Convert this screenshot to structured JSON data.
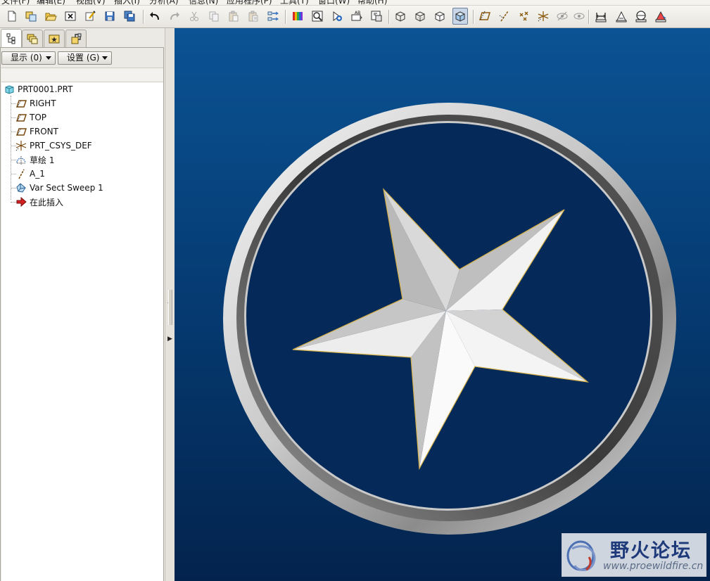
{
  "menubar": {
    "items": [
      "文件(F)",
      "编辑(E)",
      "视图(V)",
      "插入(I)",
      "分析(A)",
      "信息(N)",
      "应用程序(P)",
      "工具(T)",
      "窗口(W)",
      "帮助(H)"
    ]
  },
  "toolbar": {
    "buttons": [
      {
        "icon": "new-file-icon"
      },
      {
        "icon": "open-session-icon"
      },
      {
        "icon": "open-folder-icon"
      },
      {
        "icon": "close-window-icon"
      },
      {
        "icon": "regenerate-icon"
      },
      {
        "icon": "save-icon"
      },
      {
        "icon": "save-copy-icon"
      },
      {
        "icon": "undo-icon"
      },
      {
        "icon": "redo-icon"
      },
      {
        "icon": "cut-icon"
      },
      {
        "icon": "copy-icon"
      },
      {
        "icon": "paste-icon"
      },
      {
        "icon": "paste-special-icon"
      },
      {
        "icon": "swap-icon"
      },
      {
        "icon": "color-bar-icon"
      },
      {
        "icon": "zoom-fit-icon"
      },
      {
        "icon": "zoom-in-icon"
      },
      {
        "icon": "annotation-icon"
      },
      {
        "icon": "repaint-icon"
      },
      {
        "icon": "wireframe-icon"
      },
      {
        "icon": "hidden-line-icon"
      },
      {
        "icon": "no-hidden-icon"
      },
      {
        "icon": "shading-icon"
      },
      {
        "icon": "datum-plane-icon"
      },
      {
        "icon": "datum-axis-icon"
      },
      {
        "icon": "datum-point-icon"
      },
      {
        "icon": "csys-icon"
      },
      {
        "icon": "hide-icon"
      },
      {
        "icon": "show-icon"
      },
      {
        "icon": "measure-distance-icon"
      },
      {
        "icon": "measure-angle-icon"
      },
      {
        "icon": "measure-diameter-icon"
      },
      {
        "icon": "measure-area-icon"
      }
    ],
    "active": "shading-icon"
  },
  "navigator": {
    "tabs": [
      "model-tree-icon",
      "layer-tree-icon",
      "favorites-icon",
      "connection-icon"
    ],
    "show_label": "显示 (0)",
    "settings_label": "设置 (G)",
    "tree": [
      {
        "label": "PRT0001.PRT",
        "icon": "part-icon",
        "indent": 0
      },
      {
        "label": "RIGHT",
        "icon": "datum-plane-icon",
        "indent": 1
      },
      {
        "label": "TOP",
        "icon": "datum-plane-icon",
        "indent": 1
      },
      {
        "label": "FRONT",
        "icon": "datum-plane-icon",
        "indent": 1
      },
      {
        "label": "PRT_CSYS_DEF",
        "icon": "csys-icon",
        "indent": 1
      },
      {
        "label": "草绘 1",
        "icon": "sketch-icon",
        "indent": 1
      },
      {
        "label": "A_1",
        "icon": "datum-axis-icon",
        "indent": 1
      },
      {
        "label": "Var Sect Sweep 1",
        "icon": "sweep-feature-icon",
        "indent": 1
      },
      {
        "label": "在此插入",
        "icon": "insert-here-arrow-icon",
        "indent": 1
      }
    ]
  },
  "viewport": {
    "background_top": "#0b5394",
    "background_bottom": "#03234d",
    "model": "star-emblem-in-ring"
  },
  "watermark": {
    "title": "野火论坛",
    "url": "www.proewildfire.cn",
    "logo_icon": "fire-swirl-logo"
  }
}
